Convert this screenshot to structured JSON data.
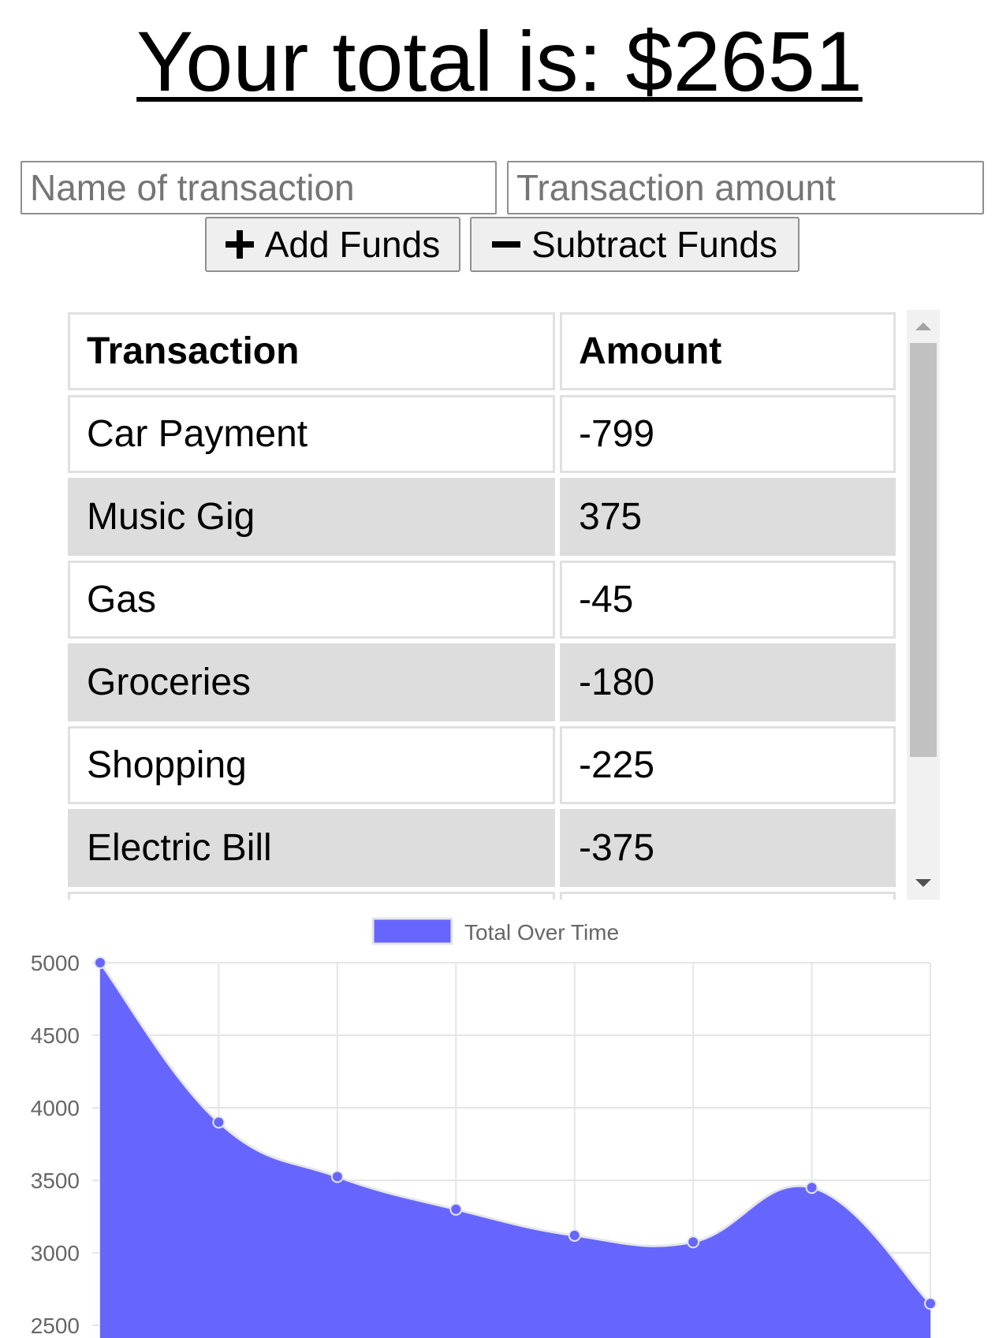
{
  "header": {
    "title": "Your total is: $2651"
  },
  "form": {
    "name_placeholder": "Name of transaction",
    "amount_placeholder": "Transaction amount",
    "add_label": "Add Funds",
    "subtract_label": "Subtract Funds",
    "add_icon": "plus-icon",
    "subtract_icon": "minus-icon"
  },
  "table": {
    "headers": [
      "Transaction",
      "Amount"
    ],
    "rows": [
      [
        "Car Payment",
        "-799"
      ],
      [
        "Music Gig",
        "375"
      ],
      [
        "Gas",
        "-45"
      ],
      [
        "Groceries",
        "-180"
      ],
      [
        "Shopping",
        "-225"
      ],
      [
        "Electric Bill",
        "-375"
      ]
    ]
  },
  "colors": {
    "series_fill": "#6666ff",
    "series_line": "#e6e6e6",
    "grid": "#e5e5e5",
    "tick_text": "#666666"
  },
  "chart_data": {
    "type": "area",
    "legend": [
      "Total Over Time"
    ],
    "legend_position": "top",
    "grid": true,
    "ylim": [
      2500,
      5000
    ],
    "y_ticks": [
      "5000",
      "4500",
      "4000",
      "3500",
      "3000",
      "2500"
    ],
    "series": [
      {
        "name": "Total Over Time",
        "values": [
          5000,
          3900,
          3525,
          3300,
          3120,
          3075,
          3450,
          2651
        ]
      }
    ]
  }
}
